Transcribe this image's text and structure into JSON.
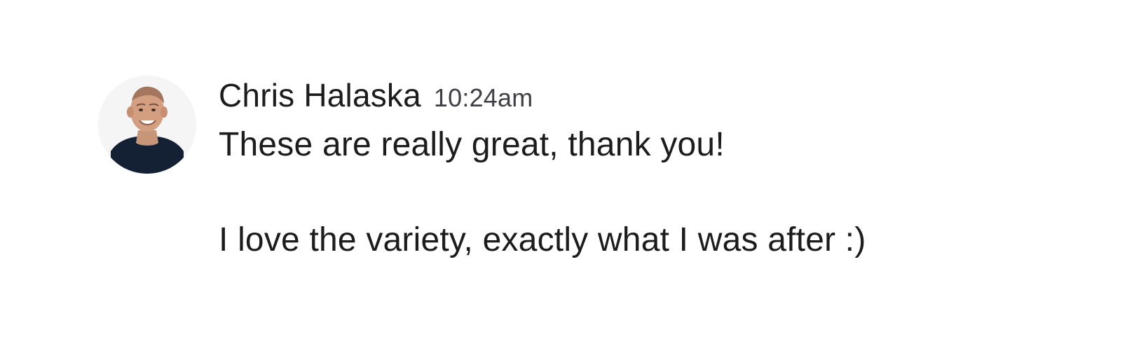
{
  "message": {
    "author": "Chris Halaska",
    "time": "10:24am",
    "lines": [
      "These are really great, thank you!",
      "I love the variety, exactly what I was after :)"
    ],
    "avatar_icon": "profile-photo"
  },
  "colors": {
    "author_text": "#1c1c1c",
    "timestamp_text": "#3f3f46",
    "avatar_background": "#f4f4f4",
    "shirt": "#142033"
  }
}
